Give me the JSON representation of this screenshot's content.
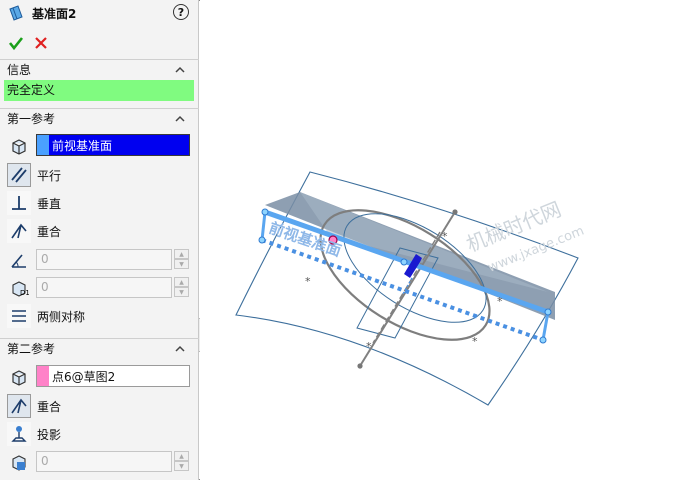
{
  "title": "基准面2",
  "help_glyph": "?",
  "sections": {
    "info": {
      "label": "信息",
      "status": "完全定义"
    },
    "first": {
      "label": "第一参考",
      "selection": "前视基准面",
      "options": [
        "平行",
        "垂直",
        "重合"
      ],
      "angle": "0",
      "distance": "0",
      "symmetric": "两侧对称"
    },
    "second": {
      "label": "第二参考",
      "selection": "点6@草图2",
      "options": [
        "重合",
        "投影"
      ],
      "value": "0"
    }
  },
  "viewport": {
    "plane_label": "前视基准面"
  },
  "watermark": {
    "line1": "机械时代网",
    "line2": "www.jxage.com"
  },
  "colors": {
    "status_bg": "#80fb80",
    "active_selection": "#0000f0",
    "swatch_first": "#4aa0ff",
    "swatch_second": "#ff82c8",
    "preview_plane": "#4a90e2"
  },
  "icons": [
    "plane-icon",
    "help-icon",
    "ok-check-icon",
    "cancel-x-icon",
    "chevron-up-icon",
    "reference-cube-icon",
    "parallel-icon",
    "perpendicular-icon",
    "coincident-icon",
    "angle-icon",
    "distance-icon",
    "symmetric-icon",
    "projection-icon"
  ]
}
